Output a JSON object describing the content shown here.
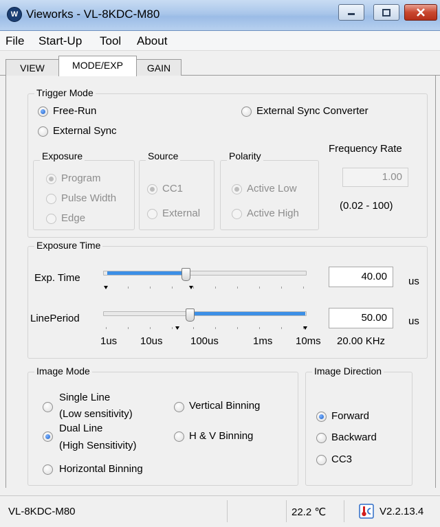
{
  "window": {
    "title": "Vieworks - VL-8KDC-M80",
    "app_icon": "vieworks-logo-icon"
  },
  "menu": [
    "File",
    "Start-Up",
    "Tool",
    "About"
  ],
  "tabs": [
    {
      "label": "VIEW"
    },
    {
      "label": "MODE/EXP",
      "active": true
    },
    {
      "label": "GAIN"
    }
  ],
  "trigger_mode": {
    "title": "Trigger Mode",
    "free_run": "Free-Run",
    "external_sync": "External Sync",
    "external_sync_converter": "External Sync Converter",
    "selected": "Free-Run",
    "exposure": {
      "title": "Exposure",
      "program": "Program",
      "pulse_width": "Pulse Width",
      "edge": "Edge",
      "selected": "Program"
    },
    "source": {
      "title": "Source",
      "cc1": "CC1",
      "external": "External",
      "selected": "CC1"
    },
    "polarity": {
      "title": "Polarity",
      "active_low": "Active Low",
      "active_high": "Active High",
      "selected": "Active Low"
    },
    "frequency_rate": {
      "title": "Frequency Rate",
      "value": "1.00",
      "range": "(0.02 - 100)"
    }
  },
  "exposure_time": {
    "title": "Exposure Time",
    "exp_time": {
      "label": "Exp. Time",
      "value": "40.00",
      "unit": "us",
      "slider_position": 0.4
    },
    "line_period": {
      "label": "LinePeriod",
      "value": "50.00",
      "unit": "us",
      "slider_position": 0.42
    },
    "scale_labels": [
      "1us",
      "10us",
      "100us",
      "1ms",
      "10ms"
    ],
    "frequency_readout": "20.00 KHz"
  },
  "image_mode": {
    "title": "Image Mode",
    "single_line": [
      "Single Line",
      "(Low sensitivity)"
    ],
    "dual_line": [
      "Dual Line",
      "(High Sensitivity)"
    ],
    "horizontal_binning": "Horizontal Binning",
    "vertical_binning": "Vertical Binning",
    "hv_binning": "H & V Binning",
    "selected": "Dual Line"
  },
  "image_direction": {
    "title": "Image Direction",
    "forward": "Forward",
    "backward": "Backward",
    "cc3": "CC3",
    "selected": "Forward"
  },
  "status": {
    "model": "VL-8KDC-M80",
    "temperature": "22.2 ℃",
    "thermometer_icon": "thermometer-icon",
    "version": "V2.2.13.4"
  },
  "colors": {
    "accent": "#3c8fe6",
    "radio_selected": "#1a5fc8",
    "close_button": "#c9472f"
  }
}
